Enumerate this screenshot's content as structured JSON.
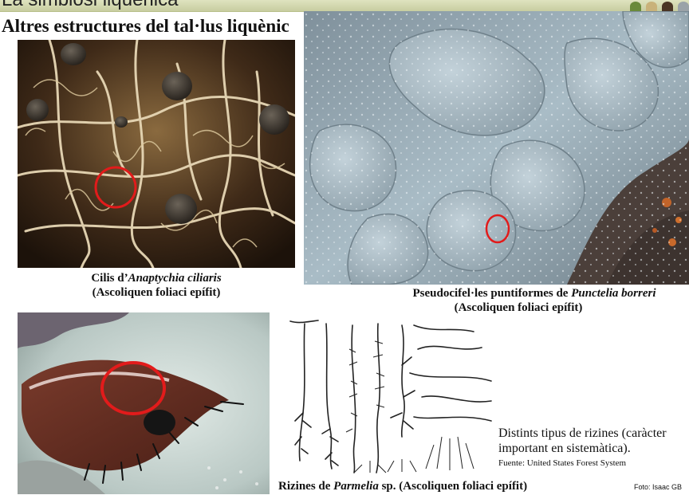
{
  "header": {
    "title": "La simbiosi liquènica"
  },
  "section_title": "Altres estructures del tal·lus liquènic",
  "photo1": {
    "caption_line1_prefix": "Cilis d’",
    "caption_line1_italic": "Anaptychia ciliaris",
    "caption_line2": "(Ascoliquen foliaci epífit)"
  },
  "photo2": {
    "caption_line1_prefix": "Pseudocifel·les puntiformes de ",
    "caption_line1_italic": "Punctelia borreri",
    "caption_line2": "(Ascoliquen foliaci epífit)"
  },
  "photo4": {
    "caption_prefix": "Rizines de ",
    "caption_italic": "Parmelia",
    "caption_suffix": " sp. (Ascoliquen foliaci epífit)"
  },
  "note": {
    "line1": "Distints tipus de rizines (caràcter",
    "line2": "important en sistemàtica).",
    "source": "Fuente: United States Forest System"
  },
  "credit": "Foto: Isaac GB",
  "colors": {
    "highlight": "#e21b1b",
    "header_bg": "#d3d8ae"
  }
}
